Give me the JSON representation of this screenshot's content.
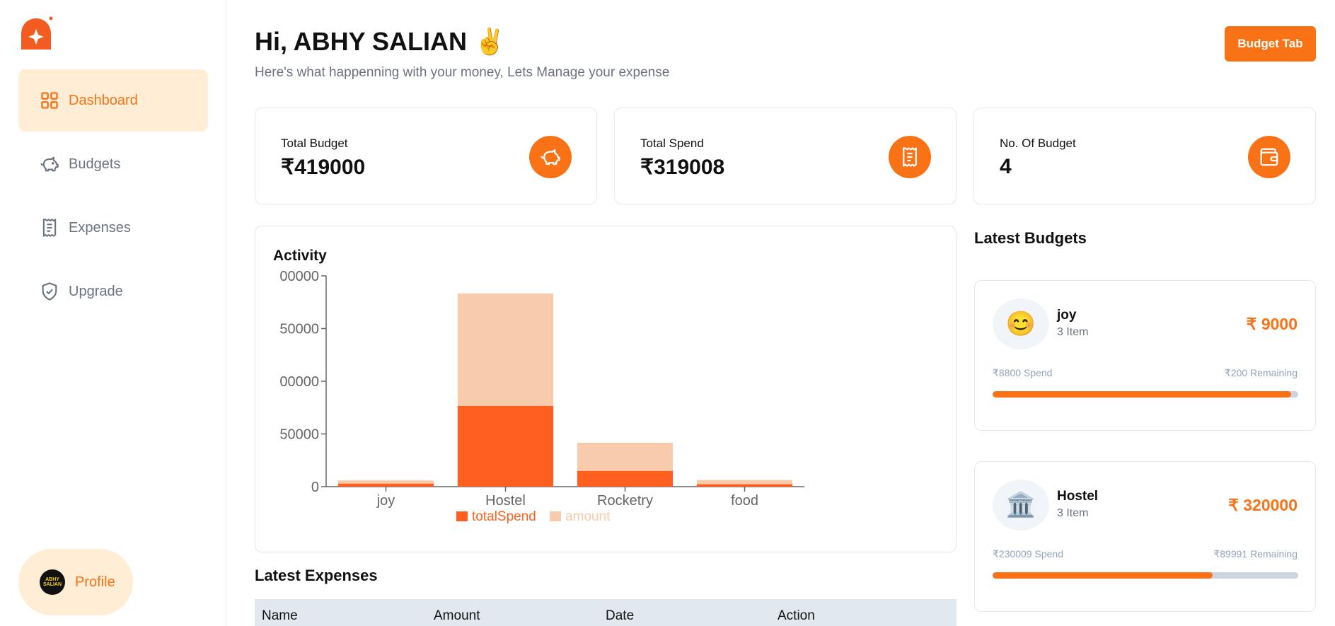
{
  "sidebar": {
    "items": [
      {
        "label": "Dashboard",
        "icon": "grid-icon",
        "active": true
      },
      {
        "label": "Budgets",
        "icon": "piggy-bank-icon",
        "active": false
      },
      {
        "label": "Expenses",
        "icon": "receipt-icon",
        "active": false
      },
      {
        "label": "Upgrade",
        "icon": "shield-check-icon",
        "active": false
      }
    ],
    "profile_label": "Profile",
    "avatar_text": "ABHY SALIAN"
  },
  "header": {
    "greeting": "Hi, ABHY SALIAN ✌️",
    "subtitle": "Here's what happenning with your money, Lets Manage your expense",
    "budget_tab_label": "Budget Tab"
  },
  "stats": [
    {
      "label": "Total Budget",
      "value": "₹419000",
      "icon": "piggy-bank-icon"
    },
    {
      "label": "Total Spend",
      "value": "₹319008",
      "icon": "receipt-icon"
    },
    {
      "label": "No. Of Budget",
      "value": "4",
      "icon": "wallet-icon"
    }
  ],
  "activity": {
    "title": "Activity"
  },
  "chart_data": {
    "type": "bar",
    "stacked": true,
    "categories": [
      "joy",
      "Hostel",
      "Rocketry",
      "food"
    ],
    "series": [
      {
        "name": "totalSpend",
        "values": [
          8800,
          230009,
          45000,
          7000
        ],
        "color": "#ff5f1f"
      },
      {
        "name": "amount",
        "values": [
          9000,
          320000,
          80000,
          12000
        ],
        "color": "#f9cbad"
      }
    ],
    "ylim": [
      0,
      600000
    ],
    "yticks": [
      0,
      150000,
      300000,
      450000,
      600000
    ],
    "ytick_labels": [
      "0",
      "50000",
      "00000",
      "50000",
      "00000"
    ],
    "legend": "bottom-center",
    "grid": false
  },
  "latest_expenses": {
    "title": "Latest Expenses",
    "columns": [
      "Name",
      "Amount",
      "Date",
      "Action"
    ]
  },
  "latest_budgets": {
    "title": "Latest Budgets",
    "items": [
      {
        "emoji": "😊",
        "name": "joy",
        "items": "3 Item",
        "amount": "₹ 9000",
        "spend": "₹8800 Spend",
        "remaining": "₹200 Remaining",
        "progress": 0.978
      },
      {
        "emoji": "🏛️",
        "name": "Hostel",
        "items": "3 Item",
        "amount": "₹ 320000",
        "spend": "₹230009 Spend",
        "remaining": "₹89991 Remaining",
        "progress": 0.719
      }
    ]
  },
  "colors": {
    "accent": "#f97316",
    "accent_light": "#ffedd5",
    "bar_spend": "#ff5f1f",
    "bar_amount": "#f9cbad"
  }
}
